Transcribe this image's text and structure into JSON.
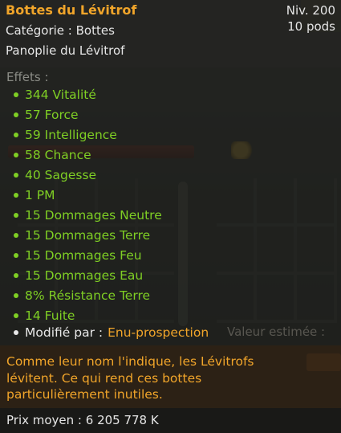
{
  "item": {
    "name": "Bottes du Lévitrof",
    "level": "Niv. 200",
    "weight": "10 pods",
    "category": "Catégorie : Bottes",
    "set": "Panoplie du Lévitrof"
  },
  "effects": {
    "title": "Effets :",
    "lines": [
      "344 Vitalité",
      "57 Force",
      "59 Intelligence",
      "58 Chance",
      "40 Sagesse",
      "1 PM",
      "15 Dommages Neutre",
      "15 Dommages Terre",
      "15 Dommages Feu",
      "15 Dommages Eau",
      "8% Résistance Terre",
      "14 Fuite"
    ],
    "modified_label": "Modifié par :",
    "modified_value": "Enu-prospection"
  },
  "description": "Comme leur nom l'indique, les Lévitrofs lévitent. Ce qui rend ces bottes particulièrement inutiles.",
  "price": "Prix moyen : 6 205 778 K",
  "background": {
    "estimate_label": "Valeur estimée :"
  },
  "colors": {
    "name": "#f1a52a",
    "effect": "#7fcf24",
    "description": "#f1a52a",
    "text": "#e6e6e6",
    "muted": "#8b8c86"
  }
}
